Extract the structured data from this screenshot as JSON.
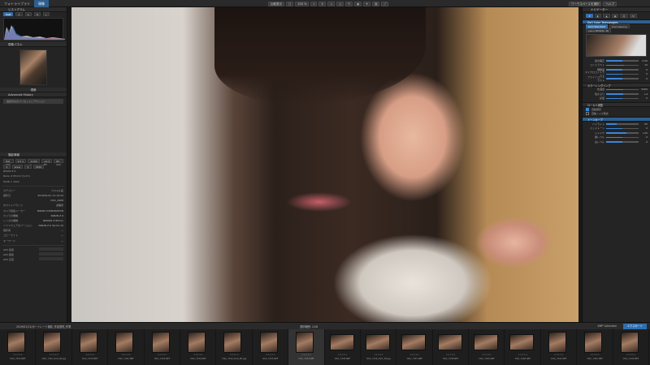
{
  "topbar": {
    "tabs": [
      "フォトライブラリ",
      "現像"
    ],
    "zoom": "100 %",
    "compare": "比較表示",
    "right_buttons": [
      "ワークスペースを選択",
      "ヘルプ"
    ]
  },
  "left": {
    "histogram_title": "ヒストグラム",
    "hist_chips": [
      "RGB",
      "R",
      "G",
      "B",
      "L"
    ],
    "preset_title": "現像パネル",
    "preset_label": "現像",
    "advanced_history": "Advanced History",
    "history_item": "適用済みのプリセットとアクション",
    "info_title": "撮影情報",
    "exif_row": [
      "ISO 400",
      "1/7.1",
      "1/100 s",
      "+0.3 EV",
      "85 mm"
    ],
    "exif_row2": [
      "±",
      "≡≡≡",
      "↕",
      "3456"
    ],
    "camera": "NIKON Z 6",
    "lens": "Nikon Z 85mm f/1.8 S",
    "size": "6048 × 4024",
    "meta": [
      {
        "k": "カテゴリー",
        "v": "ファイル名"
      },
      {
        "k": "撮影日",
        "v": "2019/01/11 11:14:24"
      },
      {
        "k": "",
        "v": "DSC_2468"
      },
      {
        "k": "ホワイトバランス",
        "v": "太陽光"
      },
      {
        "k": "カメラ製造メーカー",
        "v": "NIKON CORPORATION"
      },
      {
        "k": "カメラの機種",
        "v": "NIKON Z 6"
      },
      {
        "k": "レンズの機種",
        "v": "NIKKOR Z 85mm"
      },
      {
        "k": "ソフトウェアのバージョン",
        "v": "NIKON Z 6 Ver.01.10"
      },
      {
        "k": "撮影者",
        "v": "---"
      },
      {
        "k": "コピーライト",
        "v": "---"
      },
      {
        "k": "キーワード",
        "v": "---"
      }
    ],
    "gps": [
      "GPS 緯度",
      "GPS 経度",
      "GPS 高度"
    ]
  },
  "right": {
    "nav_title": "ナビゲーター",
    "profile_title": "DxO Color Technologies",
    "profile_opts": [
      "DxO Standard",
      "DxO Neutral",
      "Leica PRISMA 3D"
    ],
    "sliders": [
      {
        "label": "露光補正",
        "value": "0.00",
        "pct": 0.5
      },
      {
        "label": "コントラスト",
        "value": "12",
        "pct": 0.56
      },
      {
        "label": "明瞭度",
        "value": "0",
        "pct": 0.5
      },
      {
        "label": "マイクロコントラスト",
        "value": "0",
        "pct": 0.5
      },
      {
        "label": "ファインコントラスト",
        "value": "0",
        "pct": 0.5
      }
    ],
    "section2": "カラーレンダリング",
    "wb_sliders": [
      {
        "label": "色温度",
        "value": "5200",
        "pct": 0.52
      },
      {
        "label": "色かぶり",
        "value": "+4",
        "pct": 0.53
      },
      {
        "label": "彩度",
        "value": "0",
        "pct": 0.5
      }
    ],
    "section3": "ローカル調整",
    "toggles": [
      "自動保存",
      "自動ノイズ除去"
    ],
    "section4": "トーンカーブ",
    "tone_sliders": [
      {
        "label": "ハイライト",
        "value": "-35",
        "pct": 0.33
      },
      {
        "label": "ミッドトーン",
        "value": "0",
        "pct": 0.5
      },
      {
        "label": "シャドウ",
        "value": "+25",
        "pct": 0.62
      },
      {
        "label": "黒レベル",
        "value": "0",
        "pct": 0.5
      },
      {
        "label": "白レベル",
        "value": "0",
        "pct": 0.5
      }
    ]
  },
  "filmbar": {
    "path": "2019/01/11/ポートレート撮影_作品選別_作業",
    "count": "選択範囲: 1/28",
    "right_label": "XMP Collection",
    "export_button": "エクスポート"
  },
  "film": [
    {
      "name": "DSC_7432.NEF",
      "land": false
    },
    {
      "name": "DSC_7432_DxO_Mt.jpg",
      "land": false
    },
    {
      "name": "DSC_7433.NEF",
      "land": false
    },
    {
      "name": "DSC_7432.NEF",
      "land": false
    },
    {
      "name": "DSC_7433.NEF",
      "land": false
    },
    {
      "name": "DSC_7434.NEF",
      "land": false
    },
    {
      "name": "DSC_7432_DxO_Mt.jpg",
      "land": false
    },
    {
      "name": "DSC_7433.NEF",
      "land": false
    },
    {
      "name": "DSC_7434.NEF",
      "land": false
    },
    {
      "name": "DSC_7435.NEF",
      "land": true
    },
    {
      "name": "DSC_7436_DxO_Mt.jpg",
      "land": true
    },
    {
      "name": "DSC_7437.NEF",
      "land": true
    },
    {
      "name": "DSC_7438.NEF",
      "land": true
    },
    {
      "name": "DSC_7439.NEF",
      "land": true
    },
    {
      "name": "DSC_7440.NEF",
      "land": true
    },
    {
      "name": "DSC_7441.NEF",
      "land": false
    },
    {
      "name": "DSC_7442.NEF",
      "land": false
    },
    {
      "name": "DSC_7443.NEF",
      "land": false
    }
  ],
  "colors": {
    "accent": "#2f6fb0",
    "panel": "#242424",
    "bg": "#1b1b1b"
  }
}
